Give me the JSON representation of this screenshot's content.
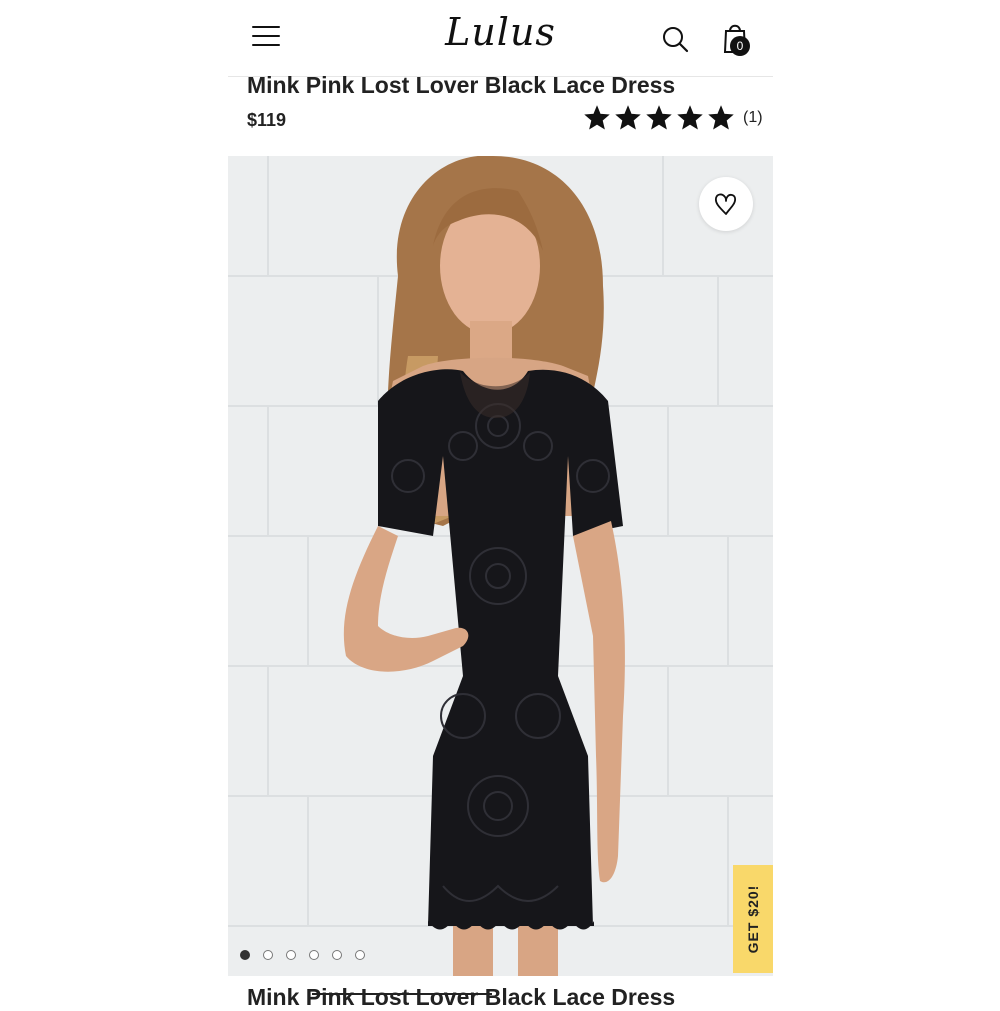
{
  "header": {
    "logo_text": "Lulus",
    "menu_icon": "hamburger-menu-icon",
    "search_icon": "search-icon",
    "bag_icon": "shopping-bag-icon",
    "bag_count": "0"
  },
  "product": {
    "title": "Mink Pink Lost Lover Black Lace Dress",
    "price": "$119",
    "rating": {
      "stars": 5,
      "max": 5,
      "count_label": "(1)"
    }
  },
  "gallery": {
    "favorite_icon": "heart-icon",
    "slide_count": 6,
    "active_slide": 1
  },
  "promo": {
    "label": "GET $20!",
    "color": "#f9d86a"
  },
  "next_section": {
    "title": "Mink Pink Lost Lover Black Lace Dress"
  }
}
